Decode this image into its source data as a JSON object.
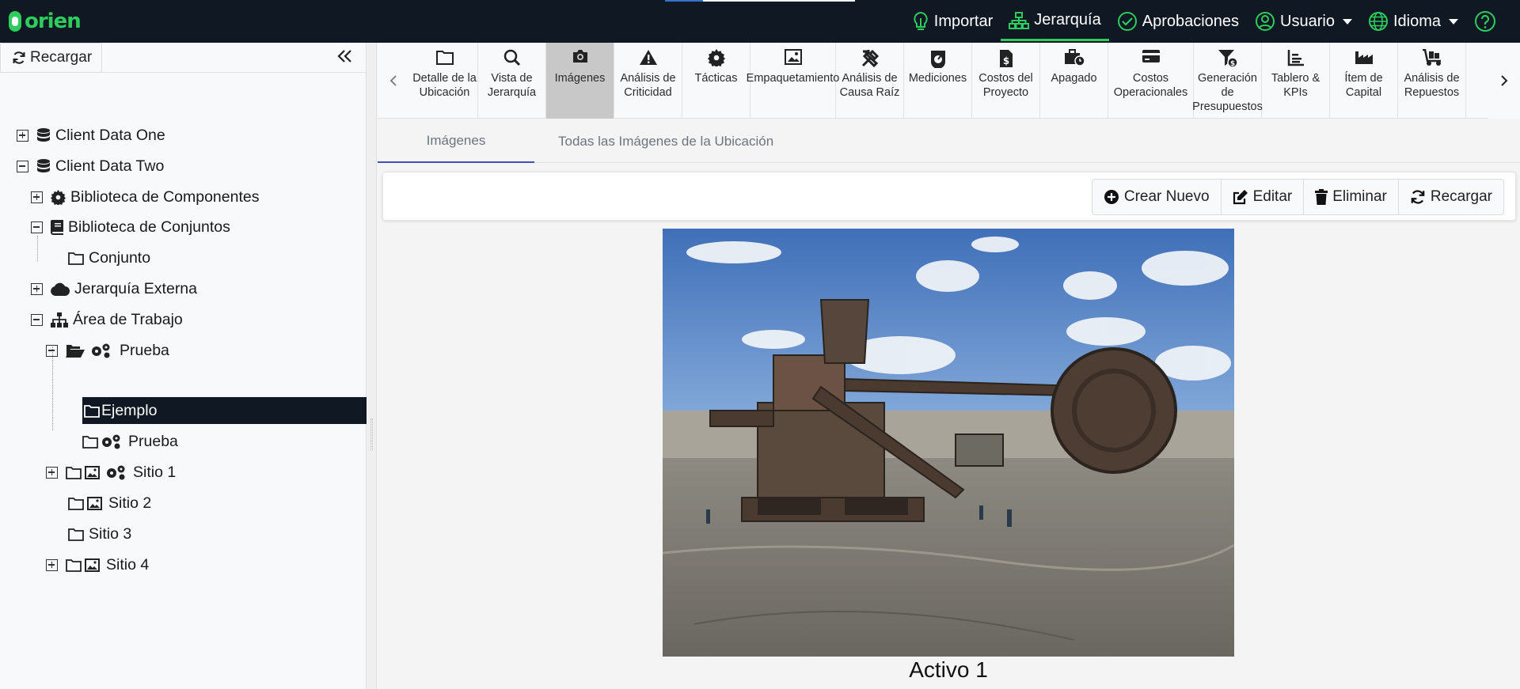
{
  "brand": {
    "name": "orien",
    "color": "#2ecc5c"
  },
  "topnav": {
    "items": [
      {
        "label": "Importar",
        "icon": "lightbulb-icon"
      },
      {
        "label": "Jerarquía",
        "icon": "sitemap-icon",
        "active": true
      },
      {
        "label": "Aprobaciones",
        "icon": "check-circle-icon"
      },
      {
        "label": "Usuario",
        "icon": "user-circle-icon",
        "dropdown": true
      },
      {
        "label": "Idioma",
        "icon": "globe-icon",
        "dropdown": true
      }
    ],
    "help_icon": "question-circle-icon"
  },
  "sidebar": {
    "reload_label": "Recargar",
    "collapse_icon": "double-chevron-left-icon",
    "tree": [
      {
        "label": "Client Data One",
        "icon": "database-icon",
        "toggle": "plus"
      },
      {
        "label": "Client Data Two",
        "icon": "database-icon",
        "toggle": "minus"
      },
      {
        "label": "Biblioteca de Componentes",
        "icon": "gear-icon",
        "toggle": "plus"
      },
      {
        "label": "Biblioteca de Conjuntos",
        "icon": "book-icon",
        "toggle": "minus"
      },
      {
        "label": "Conjunto",
        "icon": "folder-icon"
      },
      {
        "label": "Jerarquía Externa",
        "icon": "cloud-icon",
        "toggle": "plus"
      },
      {
        "label": "Área de Trabajo",
        "icon": "sitemap-icon",
        "toggle": "minus"
      },
      {
        "label": "Prueba",
        "icon": "folder-open-gears-icon",
        "toggle": "minus"
      },
      {
        "label": "Ejemplo",
        "icon": "folder-icon",
        "selected": true
      },
      {
        "label": "Prueba",
        "icon": "folder-gears-icon"
      },
      {
        "label": "Sitio 1",
        "icon": "folder-image-gears-icon",
        "toggle": "plus"
      },
      {
        "label": "Sitio 2",
        "icon": "folder-image-icon"
      },
      {
        "label": "Sitio 3",
        "icon": "folder-icon"
      },
      {
        "label": "Sitio 4",
        "icon": "folder-image-icon",
        "toggle": "plus"
      }
    ]
  },
  "toolbar": {
    "tools": [
      {
        "label": "Detalle de la Ubicación",
        "icon": "folder-icon"
      },
      {
        "label": "Vista de Jerarquía",
        "icon": "search-icon"
      },
      {
        "label": "Imágenes",
        "icon": "camera-icon",
        "active": true
      },
      {
        "label": "Análisis de Criticidad",
        "icon": "warning-icon"
      },
      {
        "label": "Tácticas",
        "icon": "gear-icon"
      },
      {
        "label": "Empaquetamiento",
        "icon": "image-box-icon"
      },
      {
        "label": "Análisis de Causa Raíz",
        "icon": "tools-icon"
      },
      {
        "label": "Mediciones",
        "icon": "gauge-icon"
      },
      {
        "label": "Costos del Proyecto",
        "icon": "dollar-file-icon"
      },
      {
        "label": "Apagado",
        "icon": "briefcase-clock-icon"
      },
      {
        "label": "Costos Operacionales",
        "icon": "credit-card-icon"
      },
      {
        "label": "Generación de Presupuestos",
        "icon": "filter-dollar-icon"
      },
      {
        "label": "Tablero & KPIs",
        "icon": "chart-icon"
      },
      {
        "label": "Ítem de Capital",
        "icon": "factory-icon"
      },
      {
        "label": "Análisis de Repuestos",
        "icon": "dolly-icon"
      }
    ]
  },
  "subtabs": [
    {
      "label": "Imágenes",
      "active": true
    },
    {
      "label": "Todas las Imágenes de la Ubicación"
    }
  ],
  "actions": [
    {
      "label": "Crear Nuevo",
      "icon": "plus-circle-icon"
    },
    {
      "label": "Editar",
      "icon": "edit-icon"
    },
    {
      "label": "Eliminar",
      "icon": "trash-icon"
    },
    {
      "label": "Recargar",
      "icon": "refresh-icon"
    }
  ],
  "image": {
    "caption": "Activo 1"
  }
}
